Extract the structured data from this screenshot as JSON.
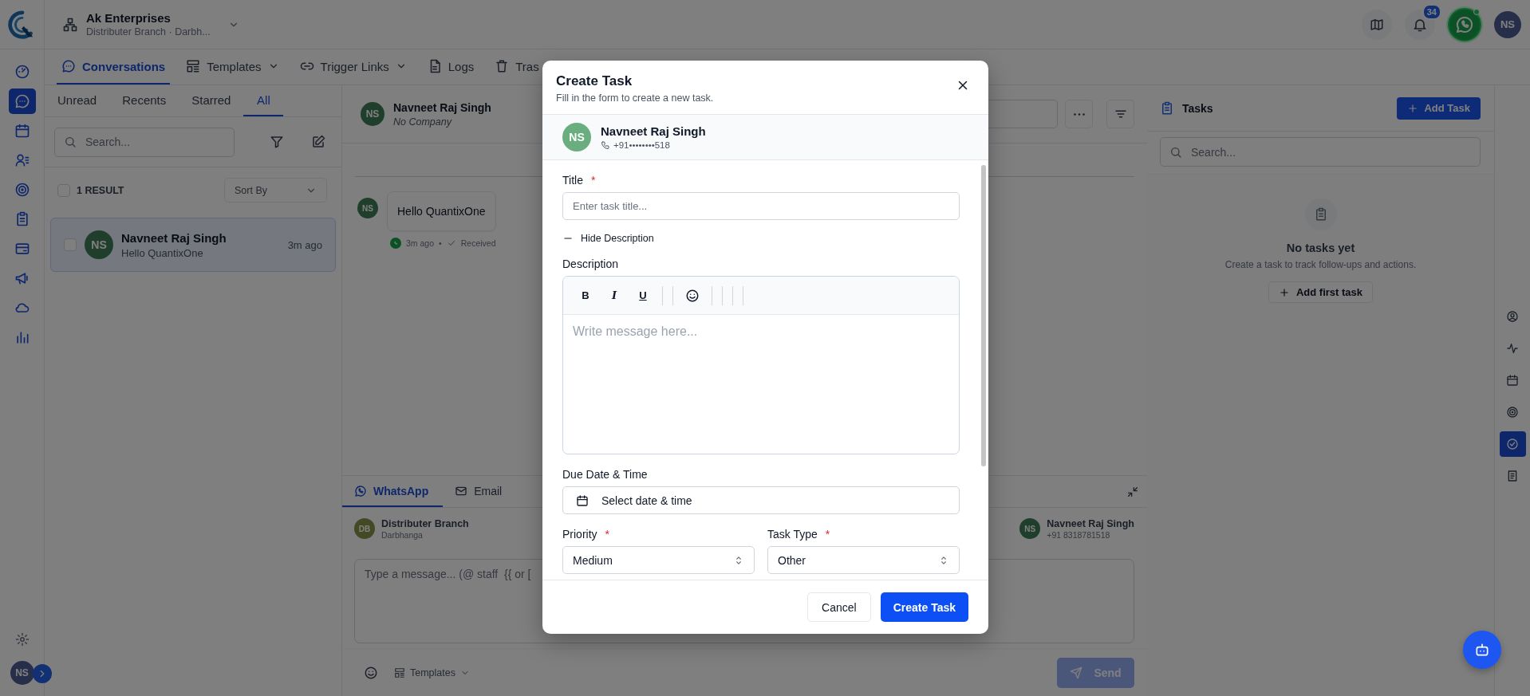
{
  "app": {
    "org_name": "Ak Enterprises",
    "org_subtitle": "Distributer Branch · Darbh...",
    "notification_count": "34",
    "whatsapp_connected": true,
    "user_initials": "NS",
    "rail_user_initials": "NS"
  },
  "rail_items": [
    {
      "kind": "gauge",
      "selected": false
    },
    {
      "kind": "chat",
      "selected": true
    },
    {
      "kind": "calendar",
      "selected": false
    },
    {
      "kind": "contacts",
      "selected": false
    },
    {
      "kind": "target",
      "selected": false
    },
    {
      "kind": "clipboard",
      "selected": false
    },
    {
      "kind": "card",
      "selected": false
    },
    {
      "kind": "megaphone",
      "selected": false
    },
    {
      "kind": "cloud",
      "selected": false
    },
    {
      "kind": "chart",
      "selected": false
    }
  ],
  "nav_tabs": [
    {
      "label": "Conversations",
      "kind": "chat",
      "selected": true,
      "dropdown": false
    },
    {
      "label": "Templates",
      "kind": "template",
      "selected": false,
      "dropdown": true
    },
    {
      "label": "Trigger Links",
      "kind": "link",
      "selected": false,
      "dropdown": true
    },
    {
      "label": "Logs",
      "kind": "file",
      "selected": false,
      "dropdown": false
    },
    {
      "label": "Tras",
      "kind": "trash",
      "selected": false,
      "dropdown": false
    }
  ],
  "filter_tabs": [
    {
      "label": "Unread",
      "selected": false
    },
    {
      "label": "Recents",
      "selected": false
    },
    {
      "label": "Starred",
      "selected": false
    },
    {
      "label": "All",
      "selected": true
    }
  ],
  "conversation_search": {
    "placeholder": "Search..."
  },
  "results": {
    "count": "1 RESULT",
    "checked": false,
    "sort_placeholder": "Sort By"
  },
  "conversations": [
    {
      "initials": "NS",
      "name": "Navneet Raj Singh",
      "preview": "Hello QuantixOne",
      "time": "3m ago",
      "selected": true,
      "checked": false
    }
  ],
  "chat_header": {
    "initials": "NS",
    "name": "Navneet Raj Singh",
    "company": "No Company"
  },
  "messages": [
    {
      "initials": "NS",
      "text": "Hello QuantixOne",
      "time": "3m ago",
      "separator": "•",
      "status": "Received"
    }
  ],
  "composer": {
    "channels": [
      {
        "label": "WhatsApp",
        "kind": "whatsapp",
        "selected": true
      },
      {
        "label": "Email",
        "kind": "mail",
        "selected": false
      }
    ],
    "sender": {
      "initials": "DB",
      "name": "Distributer Branch",
      "location": "Darbhanga"
    },
    "recipient": {
      "initials": "NS",
      "name": "Navneet Raj Singh",
      "phone": "+91 8318781518"
    },
    "placeholder": "Type a message... (@ staff  {{ or [",
    "templates_label": "Templates",
    "send_label": "Send",
    "send_disabled": true
  },
  "tasks_panel": {
    "title": "Tasks",
    "add_label": "Add Task",
    "search_placeholder": "Search...",
    "empty_title": "No tasks yet",
    "empty_text": "Create a task to track follow-ups and actions.",
    "empty_button": "Add first task"
  },
  "side_tools": [
    {
      "kind": "user",
      "selected": false
    },
    {
      "kind": "activity",
      "selected": false
    },
    {
      "kind": "calendar",
      "selected": false
    },
    {
      "kind": "target",
      "selected": false
    },
    {
      "kind": "checkcircle",
      "selected": true
    },
    {
      "kind": "notes",
      "selected": false
    }
  ],
  "modal": {
    "title": "Create Task",
    "subtitle": "Fill in the form to create a new task.",
    "contact": {
      "initials": "NS",
      "name": "Navneet Raj Singh",
      "phone": "+91••••••••518"
    },
    "title_label": "Title",
    "title_required_mark": "*",
    "title_placeholder": "Enter task title...",
    "description_toggle": "Hide Description",
    "description_label": "Description",
    "format_buttons": [
      {
        "label": "B",
        "kind": "bold"
      },
      {
        "label": "I",
        "kind": "italic"
      },
      {
        "label": "U",
        "kind": "underline"
      }
    ],
    "editor_placeholder": "Write message here...",
    "due_label": "Due Date & Time",
    "due_placeholder": "Select date & time",
    "selects": [
      {
        "label": "Priority",
        "required_mark": "*",
        "value": "Medium"
      },
      {
        "label": "Task Type",
        "required_mark": "*",
        "value": "Other"
      }
    ],
    "cancel_label": "Cancel",
    "submit_label": "Create Task"
  }
}
